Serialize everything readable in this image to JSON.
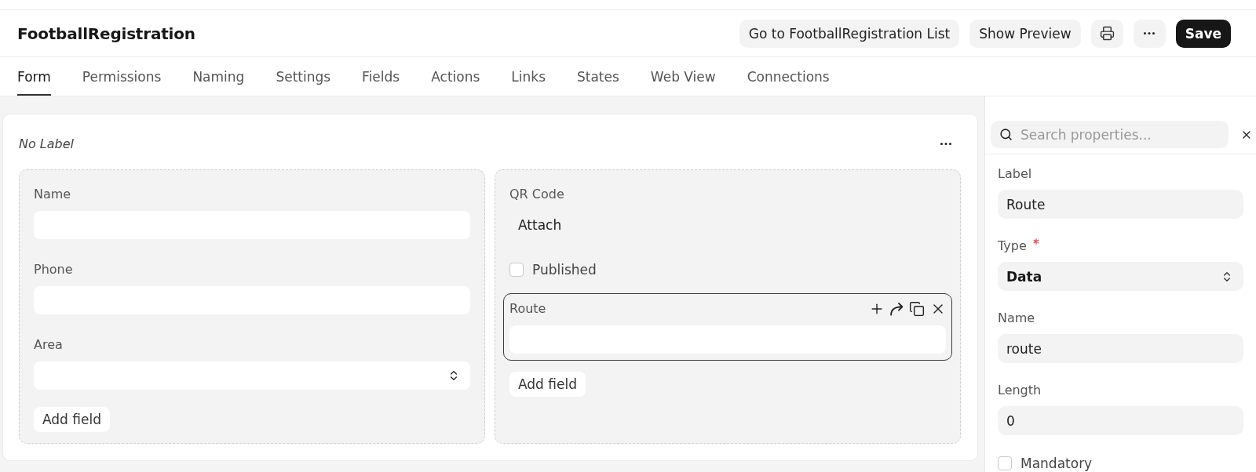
{
  "page": {
    "title": "FootballRegistration"
  },
  "header_actions": [
    {
      "kind": "text",
      "label": "Go to FootballRegistration List"
    },
    {
      "kind": "text",
      "label": "Show Preview"
    },
    {
      "kind": "print"
    },
    {
      "kind": "more"
    },
    {
      "kind": "primary",
      "label": "Save"
    }
  ],
  "tabs": [
    {
      "label": "Form",
      "selected": true
    },
    {
      "label": "Permissions",
      "selected": false
    },
    {
      "label": "Naming",
      "selected": false
    },
    {
      "label": "Settings",
      "selected": false
    },
    {
      "label": "Fields",
      "selected": false
    },
    {
      "label": "Actions",
      "selected": false
    },
    {
      "label": "Links",
      "selected": false
    },
    {
      "label": "States",
      "selected": false
    },
    {
      "label": "Web View",
      "selected": false
    },
    {
      "label": "Connections",
      "selected": false
    }
  ],
  "section": {
    "label": "No Label",
    "columns": [
      {
        "fields": [
          {
            "kind": "input",
            "label": "Name",
            "selected": false
          },
          {
            "kind": "input",
            "label": "Phone",
            "selected": false
          },
          {
            "kind": "select",
            "label": "Area",
            "selected": false
          }
        ],
        "add_button": "Add field"
      },
      {
        "fields": [
          {
            "kind": "attach",
            "label": "QR Code",
            "value": "Attach",
            "selected": false
          },
          {
            "kind": "checkbox",
            "label": "Published",
            "checked": false,
            "selected": false
          },
          {
            "kind": "input",
            "label": "Route",
            "selected": true
          }
        ],
        "add_button": "Add field"
      }
    ]
  },
  "properties": {
    "search": {
      "placeholder": "Search properties..."
    },
    "fields": [
      {
        "kind": "input",
        "label": "Label",
        "value": "Route",
        "required": false
      },
      {
        "kind": "select",
        "label": "Type",
        "value": "Data",
        "required": true
      },
      {
        "kind": "input",
        "label": "Name",
        "value": "route",
        "required": false
      },
      {
        "kind": "input",
        "label": "Length",
        "value": "0",
        "required": false
      },
      {
        "kind": "checkbox",
        "label": "Mandatory",
        "checked": false
      }
    ]
  }
}
